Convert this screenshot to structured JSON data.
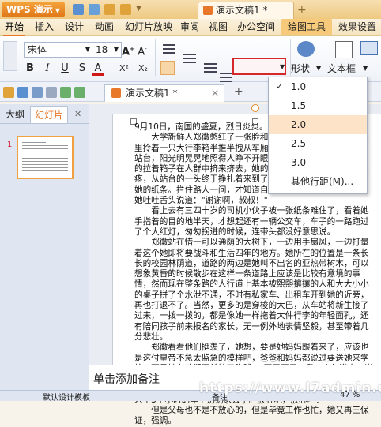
{
  "titlebar": {
    "app_name": "WPS 演示",
    "doc_tab": "演示文稿1 *",
    "add_tab": "+"
  },
  "menu": {
    "items": [
      "开始",
      "插入",
      "设计",
      "动画",
      "幻灯片放映",
      "审阅",
      "视图",
      "办公空间",
      "绘图工具",
      "效果设置"
    ]
  },
  "ribbon": {
    "font_name": "宋体",
    "font_size": "18",
    "bold": "B",
    "italic": "I",
    "underline": "U",
    "strike": "S",
    "font_color": "A",
    "superscript": "X²",
    "subscript": "X₂",
    "shape_label": "形状",
    "textbox_label": "文本框",
    "layout_label": "版式"
  },
  "file_tab": {
    "label": "演示文稿1 *",
    "add": "+"
  },
  "panel": {
    "tab_outline": "大纲",
    "tab_slides": "幻灯片",
    "slide_number": "1"
  },
  "line_spacing_menu": {
    "options": [
      "1.0",
      "1.5",
      "2.0",
      "2.5",
      "3.0",
      "其他行距(M)..."
    ],
    "check": "✓"
  },
  "slide_text": {
    "p1": "9月10日，南国的盛夏，烈日炎炎。",
    "p2": "大学新鲜人郑徽憋红了一张脸和一头汗，肩上扛着大包，手里拎着一只大行李箱半推半拽从车厢里翻了下来，抬起头来看看站台，阳光明晃晃地照得人睁不开眼，同学们有的提着行李，有的拉着箱子在人群中挤来挤去，她的手臂被行李箱的铁壳硌得生疼，从站台的一头终于挣扎着来到了出口，翻出了出门前妈妈给她的纸条。拦住路人一问，才知道自己要坐的公交车就在旁边，她吐吐舌头说道：\"谢谢啊，叔叔！\"",
    "p3": "看上去有三四十岁的司机小伙子被一张纸条难住了，看着她手指着的目的地半天，才想起还有一辆公交车，车子的一路跑过了个大红灯，匆匆拐进的时候，连带头都没好意思说。",
    "p4": "郑徽站在惜一可以通荫的大树下，一边用手扇风，一边打量着这个她即将要战斗和生活四年的地方。她所在的位置是一条长长的校园林荫道，道路的两边是她叫不出名的亚热带树木，可以想象黄昏的时候散步在这样一条道路上应该是比较有意境的事情，然而现在整条路的人行道上基本被熙熙攘攘的人和大大小小的桌子拼了个水泄不通，不时有私家车、出租车开到她的近旁，再也打退不了。当然，更多的是穿梭的大巴，从车站将新生接了过来，一拨一拨的，都是像她一样拖着大件行李的年轻面孔，还有陪同孩子前来报名的家长，无一例外地表情坚毅，甚至带着几分悲壮。",
    "p5": "郑徽看看他们挺羡了，她想，要是她妈妈跟着来了，应该也是这付皇帝不急太监急的模样吧，爸爸和妈妈都说过要送她来学校，可是她在他们面前拍了胸脯，\"不用不用，我一个年满十八岁的聪明少女，难道连入学报到都应付不来？你们老跟着我来看不出来吗？\"郑徽可是从小就很独立的，从8岁的时候已经知道一个人坐3个小时的车上奶奶家去了。放心吧，放心吧！",
    "p6": "但是父母也不是不放心的，但是毕竟工作也忙，她又再三保证，强调。"
  },
  "notes": {
    "placeholder": "单击添加备注"
  },
  "status": {
    "template": "默认设计模板",
    "notes_btn": "备注",
    "zoom": "47 %"
  },
  "watermark": "https://www.l7admin.cc",
  "colors": {
    "accent": "#e8772a",
    "highlight_border": "#d4282a",
    "selected_option_bg": "#fde3c8"
  }
}
